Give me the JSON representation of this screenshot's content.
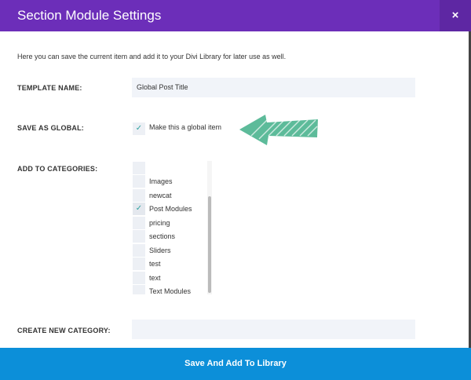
{
  "header": {
    "title": "Section Module Settings",
    "close_label": "×"
  },
  "intro": "Here you can save the current item and add it to your Divi Library for later use as well.",
  "template_name": {
    "label": "TEMPLATE NAME:",
    "value": "Global Post Title"
  },
  "save_as_global": {
    "label": "SAVE AS GLOBAL:",
    "option": "Make this a global item",
    "checked": true
  },
  "categories": {
    "label": "ADD TO CATEGORIES:",
    "items": [
      {
        "label": "",
        "checked": false
      },
      {
        "label": "Images",
        "checked": false
      },
      {
        "label": "newcat",
        "checked": false
      },
      {
        "label": "Post Modules",
        "checked": true
      },
      {
        "label": "pricing",
        "checked": false
      },
      {
        "label": "sections",
        "checked": false
      },
      {
        "label": "Sliders",
        "checked": false
      },
      {
        "label": "test",
        "checked": false
      },
      {
        "label": "text",
        "checked": false
      },
      {
        "label": "Text Modules",
        "checked": false
      }
    ]
  },
  "new_category": {
    "label": "CREATE NEW CATEGORY:",
    "value": ""
  },
  "footer": {
    "button": "Save And Add To Library"
  },
  "colors": {
    "header": "#6c2eb9",
    "footer": "#0c8fd9",
    "check": "#2ea3a0",
    "arrow": "#5dbb9a"
  }
}
